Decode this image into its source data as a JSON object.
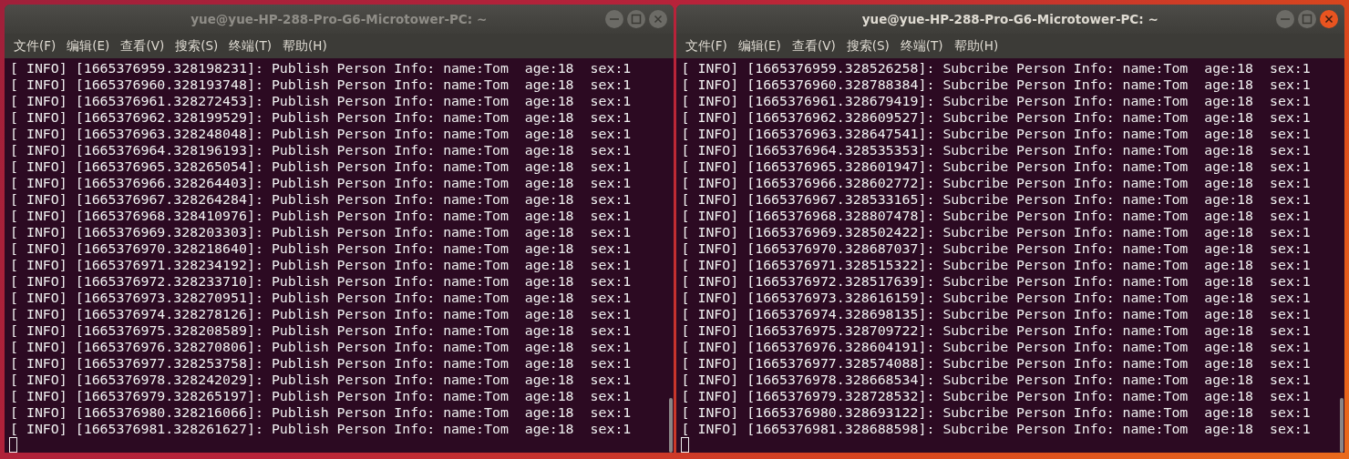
{
  "windows": [
    {
      "title": "yue@yue-HP-288-Pro-G6-Microtower-PC: ~",
      "active": false,
      "menu": [
        "文件(F)",
        "编辑(E)",
        "查看(V)",
        "搜索(S)",
        "终端(T)",
        "帮助(H)"
      ],
      "lines": [
        "[ INFO] [1665376959.328198231]: Publish Person Info: name:Tom  age:18  sex:1",
        "[ INFO] [1665376960.328193748]: Publish Person Info: name:Tom  age:18  sex:1",
        "[ INFO] [1665376961.328272453]: Publish Person Info: name:Tom  age:18  sex:1",
        "[ INFO] [1665376962.328199529]: Publish Person Info: name:Tom  age:18  sex:1",
        "[ INFO] [1665376963.328248048]: Publish Person Info: name:Tom  age:18  sex:1",
        "[ INFO] [1665376964.328196193]: Publish Person Info: name:Tom  age:18  sex:1",
        "[ INFO] [1665376965.328265054]: Publish Person Info: name:Tom  age:18  sex:1",
        "[ INFO] [1665376966.328264403]: Publish Person Info: name:Tom  age:18  sex:1",
        "[ INFO] [1665376967.328264284]: Publish Person Info: name:Tom  age:18  sex:1",
        "[ INFO] [1665376968.328410976]: Publish Person Info: name:Tom  age:18  sex:1",
        "[ INFO] [1665376969.328203303]: Publish Person Info: name:Tom  age:18  sex:1",
        "[ INFO] [1665376970.328218640]: Publish Person Info: name:Tom  age:18  sex:1",
        "[ INFO] [1665376971.328234192]: Publish Person Info: name:Tom  age:18  sex:1",
        "[ INFO] [1665376972.328233710]: Publish Person Info: name:Tom  age:18  sex:1",
        "[ INFO] [1665376973.328270951]: Publish Person Info: name:Tom  age:18  sex:1",
        "[ INFO] [1665376974.328278126]: Publish Person Info: name:Tom  age:18  sex:1",
        "[ INFO] [1665376975.328208589]: Publish Person Info: name:Tom  age:18  sex:1",
        "[ INFO] [1665376976.328270806]: Publish Person Info: name:Tom  age:18  sex:1",
        "[ INFO] [1665376977.328253758]: Publish Person Info: name:Tom  age:18  sex:1",
        "[ INFO] [1665376978.328242029]: Publish Person Info: name:Tom  age:18  sex:1",
        "[ INFO] [1665376979.328265197]: Publish Person Info: name:Tom  age:18  sex:1",
        "[ INFO] [1665376980.328216066]: Publish Person Info: name:Tom  age:18  sex:1",
        "[ INFO] [1665376981.328261627]: Publish Person Info: name:Tom  age:18  sex:1"
      ]
    },
    {
      "title": "yue@yue-HP-288-Pro-G6-Microtower-PC: ~",
      "active": true,
      "menu": [
        "文件(F)",
        "编辑(E)",
        "查看(V)",
        "搜索(S)",
        "终端(T)",
        "帮助(H)"
      ],
      "lines": [
        "[ INFO] [1665376959.328526258]: Subcribe Person Info: name:Tom  age:18  sex:1",
        "[ INFO] [1665376960.328788384]: Subcribe Person Info: name:Tom  age:18  sex:1",
        "[ INFO] [1665376961.328679419]: Subcribe Person Info: name:Tom  age:18  sex:1",
        "[ INFO] [1665376962.328609527]: Subcribe Person Info: name:Tom  age:18  sex:1",
        "[ INFO] [1665376963.328647541]: Subcribe Person Info: name:Tom  age:18  sex:1",
        "[ INFO] [1665376964.328535353]: Subcribe Person Info: name:Tom  age:18  sex:1",
        "[ INFO] [1665376965.328601947]: Subcribe Person Info: name:Tom  age:18  sex:1",
        "[ INFO] [1665376966.328602772]: Subcribe Person Info: name:Tom  age:18  sex:1",
        "[ INFO] [1665376967.328533165]: Subcribe Person Info: name:Tom  age:18  sex:1",
        "[ INFO] [1665376968.328807478]: Subcribe Person Info: name:Tom  age:18  sex:1",
        "[ INFO] [1665376969.328502422]: Subcribe Person Info: name:Tom  age:18  sex:1",
        "[ INFO] [1665376970.328687037]: Subcribe Person Info: name:Tom  age:18  sex:1",
        "[ INFO] [1665376971.328515322]: Subcribe Person Info: name:Tom  age:18  sex:1",
        "[ INFO] [1665376972.328517639]: Subcribe Person Info: name:Tom  age:18  sex:1",
        "[ INFO] [1665376973.328616159]: Subcribe Person Info: name:Tom  age:18  sex:1",
        "[ INFO] [1665376974.328698135]: Subcribe Person Info: name:Tom  age:18  sex:1",
        "[ INFO] [1665376975.328709722]: Subcribe Person Info: name:Tom  age:18  sex:1",
        "[ INFO] [1665376976.328604191]: Subcribe Person Info: name:Tom  age:18  sex:1",
        "[ INFO] [1665376977.328574088]: Subcribe Person Info: name:Tom  age:18  sex:1",
        "[ INFO] [1665376978.328668534]: Subcribe Person Info: name:Tom  age:18  sex:1",
        "[ INFO] [1665376979.328728532]: Subcribe Person Info: name:Tom  age:18  sex:1",
        "[ INFO] [1665376980.328693122]: Subcribe Person Info: name:Tom  age:18  sex:1",
        "[ INFO] [1665376981.328688598]: Subcribe Person Info: name:Tom  age:18  sex:1"
      ]
    }
  ]
}
